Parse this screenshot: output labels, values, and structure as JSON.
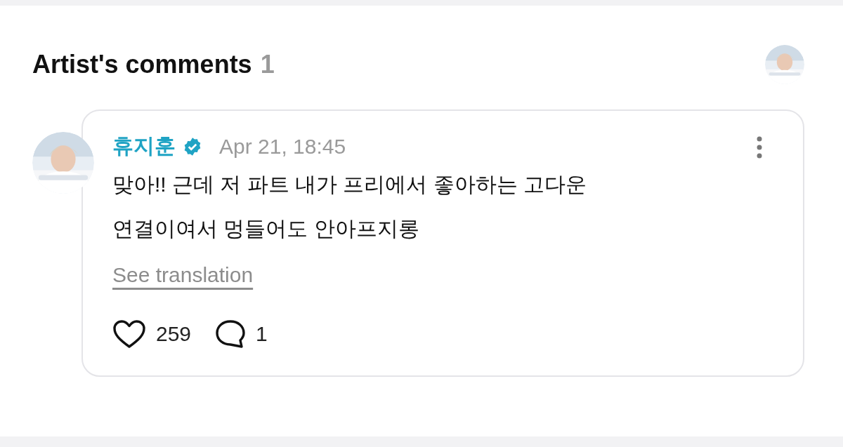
{
  "header": {
    "title": "Artist's comments",
    "count": "1"
  },
  "comment": {
    "author": "휴지훈",
    "verified": true,
    "date": "Apr 21, 18:45",
    "text": "맞아!! 근데 저 파트 내가 프리에서 좋아하는 고다운\n연결이여서 멍들어도 안아프지롱",
    "translate_link": "See translation",
    "likes": "259",
    "replies": "1"
  }
}
